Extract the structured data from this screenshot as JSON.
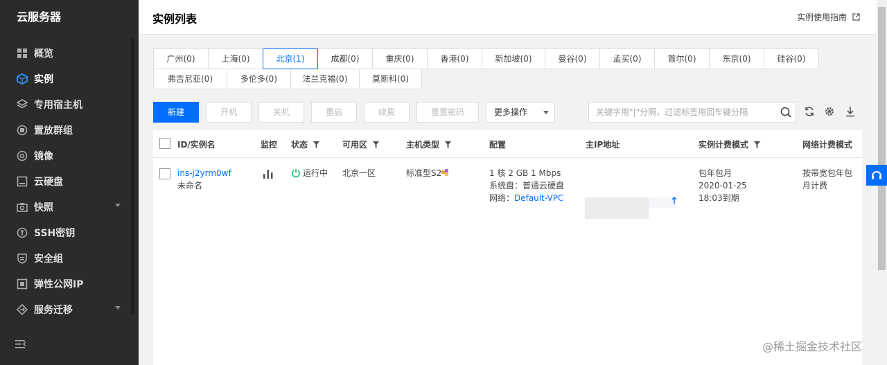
{
  "sidebar": {
    "title": "云服务器",
    "items": [
      {
        "label": "概览",
        "icon": "grid-icon"
      },
      {
        "label": "实例",
        "icon": "cube-icon",
        "active": true
      },
      {
        "label": "专用宿主机",
        "icon": "layers-icon"
      },
      {
        "label": "置放群组",
        "icon": "group-icon"
      },
      {
        "label": "镜像",
        "icon": "disc-icon"
      },
      {
        "label": "云硬盘",
        "icon": "disk-icon"
      },
      {
        "label": "快照",
        "icon": "camera-icon",
        "has_submenu": true
      },
      {
        "label": "SSH密钥",
        "icon": "key-icon"
      },
      {
        "label": "安全组",
        "icon": "shield-icon"
      },
      {
        "label": "弹性公网IP",
        "icon": "ip-icon"
      },
      {
        "label": "服务迁移",
        "icon": "migrate-icon",
        "has_submenu": true
      }
    ]
  },
  "header": {
    "title": "实例列表",
    "guide_label": "实例使用指南"
  },
  "regions": {
    "row1": [
      "广州(0)",
      "上海(0)",
      "北京(1)",
      "成都(0)",
      "重庆(0)",
      "香港(0)",
      "新加坡(0)",
      "曼谷(0)",
      "孟买(0)",
      "首尔(0)",
      "东京(0)",
      "硅谷(0)"
    ],
    "row2": [
      "弗吉尼亚(0)",
      "多伦多(0)",
      "法兰克福(0)",
      "莫斯科(0)"
    ],
    "active": "北京(1)"
  },
  "toolbar": {
    "new": "新建",
    "start": "开机",
    "stop": "关机",
    "restart": "重启",
    "renew": "续费",
    "reset_password": "重置密码",
    "more": "更多操作"
  },
  "search": {
    "placeholder": "关键字用\"|\"分隔，过滤标签用回车键分隔"
  },
  "table": {
    "headers": {
      "id": "ID/实例名",
      "monitor": "监控",
      "status": "状态",
      "zone": "可用区",
      "type": "主机类型",
      "config": "配置",
      "ip": "主IP地址",
      "billing": "实例计费模式",
      "network_billing": "网络计费模式"
    },
    "rows": [
      {
        "id": "ins-j2yrm0wf",
        "name": "未命名",
        "status": "运行中",
        "zone": "北京一区",
        "type": "标准型S2",
        "config_line1": "1 核 2 GB 1 Mbps",
        "config_line2": "系统盘：普通云硬盘",
        "config_network_label": "网络：",
        "config_network_value": "Default-VPC",
        "billing_line1": "包年包月",
        "billing_line2": "2020-01-25",
        "billing_line3": "18:03到期",
        "network_billing_line1": "按带宽包年包",
        "network_billing_line2": "月计费"
      }
    ]
  },
  "watermark": "@稀土掘金技术社区",
  "colors": {
    "accent": "#006eff",
    "sidebar_bg": "#2b2b2b",
    "status_green": "#0abf5b"
  }
}
